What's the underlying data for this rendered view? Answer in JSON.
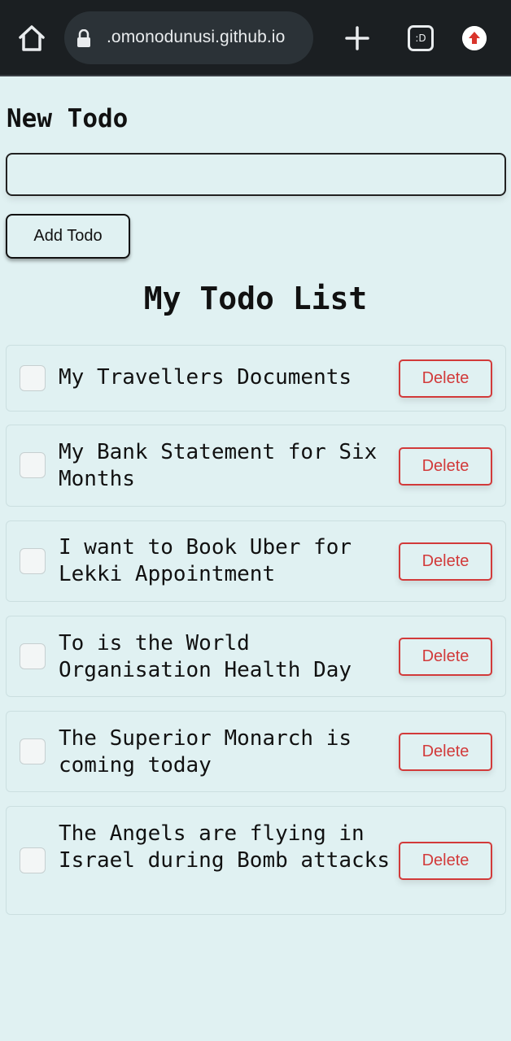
{
  "browser": {
    "url": ".omonodunusi.github.io",
    "tabs_label": ":D"
  },
  "form": {
    "label": "New Todo",
    "input_value": "",
    "add_button": "Add Todo"
  },
  "list": {
    "title": "My Todo List",
    "delete_label": "Delete",
    "items": [
      {
        "text": "My Travellers Documents",
        "checked": false
      },
      {
        "text": "My Bank Statement for Six Months",
        "checked": false
      },
      {
        "text": "I want to Book Uber for Lekki Appointment",
        "checked": false
      },
      {
        "text": "To is the World Organisation Health Day",
        "checked": false
      },
      {
        "text": "The Superior Monarch is coming today",
        "checked": false
      },
      {
        "text": "The Angels are flying in Israel during Bomb attacks",
        "checked": false
      }
    ]
  },
  "colors": {
    "page_background": "#e0f1f2",
    "browser_bar": "#1b1f22",
    "delete_accent": "#d23a3a",
    "update_icon": "#d9342b"
  }
}
